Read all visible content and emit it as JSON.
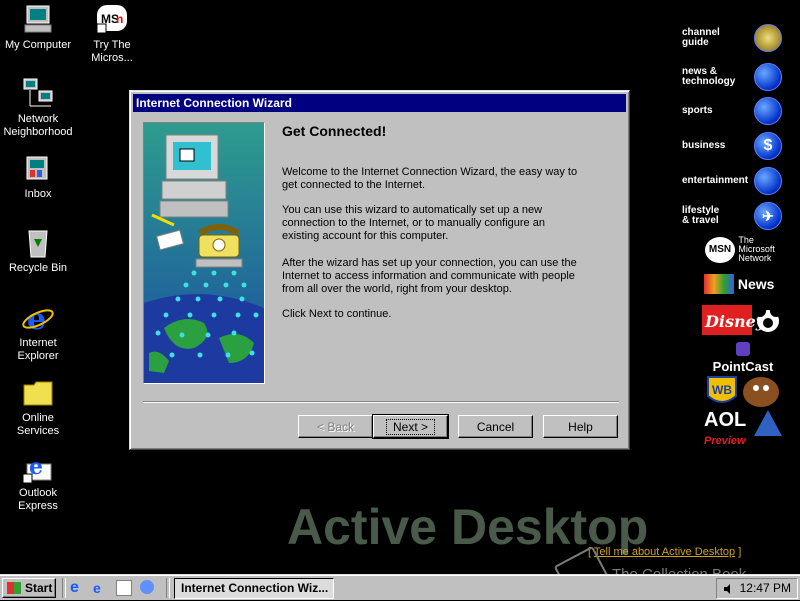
{
  "desktop_icons": [
    {
      "id": "my-computer",
      "label": "My Computer",
      "icon": "computer-icon"
    },
    {
      "id": "msn",
      "label": "Try The\nMicros...",
      "icon": "msn-icon"
    },
    {
      "id": "network",
      "label": "Network\nNeighborhood",
      "icon": "network-icon"
    },
    {
      "id": "inbox",
      "label": "Inbox",
      "icon": "inbox-icon"
    },
    {
      "id": "recycle",
      "label": "Recycle Bin",
      "icon": "recycle-bin-icon"
    },
    {
      "id": "ie",
      "label": "Internet\nExplorer",
      "icon": "internet-explorer-icon"
    },
    {
      "id": "online",
      "label": "Online\nServices",
      "icon": "folder-icon"
    },
    {
      "id": "outlook",
      "label": "Outlook\nExpress",
      "icon": "outlook-express-icon"
    }
  ],
  "channels": [
    {
      "label": "channel\nguide"
    },
    {
      "label": "news &\ntechnology"
    },
    {
      "label": "sports"
    },
    {
      "label": "business"
    },
    {
      "label": "entertainment"
    },
    {
      "label": "lifestyle\n& travel"
    }
  ],
  "channel_logos": {
    "msn_network": "The\nMicrosoft\nNetwork",
    "msnbc_news": "News",
    "pointcast": "PointCast",
    "aol_preview": "Preview",
    "aol": "AOL"
  },
  "dialog": {
    "title": "Internet Connection Wizard",
    "heading": "Get Connected!",
    "paragraphs": [
      "Welcome to the Internet Connection Wizard, the easy way to get connected to the Internet.",
      "You can use this wizard to automatically set up a new connection to the Internet, or to manually configure an existing account for this computer.",
      "After the wizard has set up your connection, you can use the Internet to access information and communicate with people from all over the world, right from your desktop.",
      "Click Next to continue."
    ],
    "buttons": {
      "back": "< Back",
      "next": "Next >",
      "cancel": "Cancel",
      "help": "Help"
    }
  },
  "watermark": "Active Desktop",
  "tell_me": "Tell me about Active Desktop",
  "collection_book": "The Collection Book",
  "taskbar": {
    "start": "Start",
    "task": "Internet Connection Wiz...",
    "clock": "12:47 PM"
  }
}
